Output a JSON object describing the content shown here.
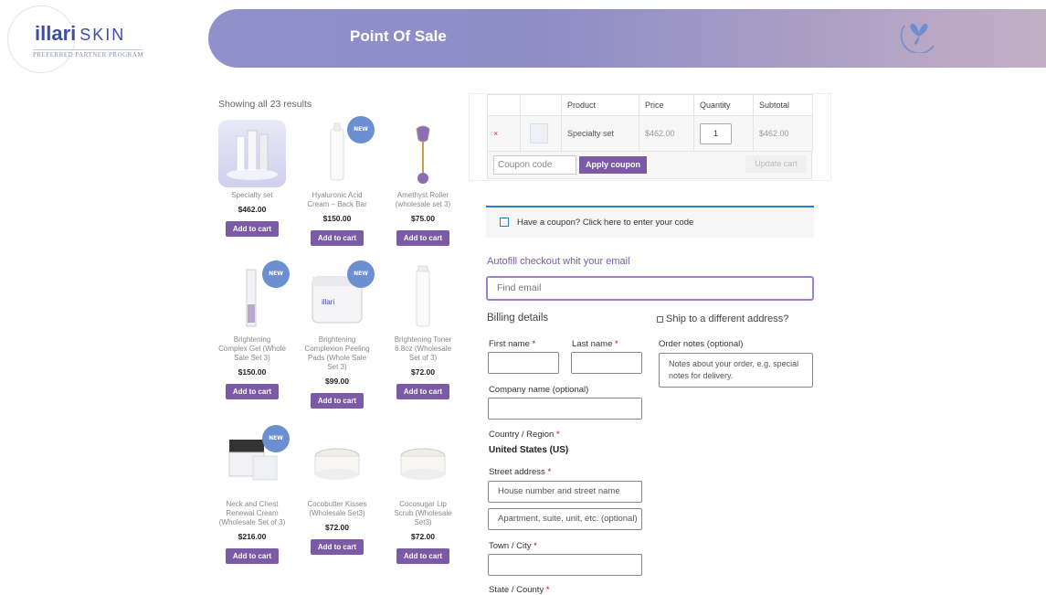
{
  "brand": {
    "name": "illari",
    "suffix": "SKIN",
    "tagline": "PREFERRED PARTNER PROGRAM"
  },
  "header": {
    "title": "Point Of Sale",
    "icon": "butterfly-icon"
  },
  "products": {
    "showing": "Showing all 23 results",
    "items": [
      {
        "name": "Specialty set",
        "price": "$462.00",
        "button": "Add to cart",
        "new": false
      },
      {
        "name": "Hyaluronic Acid Cream – Back Bar",
        "price": "$150.00",
        "button": "Add to cart",
        "new": true
      },
      {
        "name": "Amethyst Roller (wholesale set 3)",
        "price": "$75.00",
        "button": "Add to cart",
        "new": false
      },
      {
        "name": "Brightening Complex Gel (Whole Sale Set 3)",
        "price": "$150.00",
        "button": "Add to cart",
        "new": true
      },
      {
        "name": "Brightening Complexion Peeling Pads (Whole Sale Set 3)",
        "price": "$99.00",
        "button": "Add to cart",
        "new": true
      },
      {
        "name": "Brightening Toner 6.8oz (Wholesale Set of 3)",
        "price": "$72.00",
        "button": "Add to cart",
        "new": false
      },
      {
        "name": "Neck and Chest Renewal Cream (Wholesale Set of 3)",
        "price": "$216.00",
        "button": "Add to cart",
        "new": true
      },
      {
        "name": "Cocobutter Kisses (Wholesale Set3)",
        "price": "$72.00",
        "button": "Add to cart",
        "new": false
      },
      {
        "name": "Cocosugar Lip Scrub (Wholesale Set3)",
        "price": "$72.00",
        "button": "Add to cart",
        "new": false
      }
    ],
    "new_badge": "NEW"
  },
  "cart": {
    "headers": [
      "",
      "",
      "Product",
      "Price",
      "Quantity",
      "Subtotal"
    ],
    "rows": [
      {
        "remove": "×",
        "product": "Specialty set",
        "price": "$462.00",
        "quantity": "1",
        "subtotal": "$462.00"
      }
    ],
    "coupon_placeholder": "Coupon code",
    "apply_label": "Apply coupon",
    "update_label": "Update cart"
  },
  "checkout": {
    "coupon_notice": "Have a coupon? Click here to enter your code",
    "autofill_label": "Autofill checkout whit your email",
    "find_email_placeholder": "Find email",
    "billing_title": "Billing details",
    "ship_label": "Ship to a different address?",
    "first_name": "First name",
    "last_name": "Last name",
    "company": "Company name (optional)",
    "country_label": "Country / Region",
    "country_value": "United States (US)",
    "street_label": "Street address",
    "street_placeholder": "House number and street name",
    "apartment_placeholder": "Apartment, suite, unit, etc. (optional)",
    "city_label": "Town / City",
    "state_label": "State / County",
    "notes_label": "Order notes (optional)",
    "notes_placeholder": "Notes about your order, e.g. special notes for delivery.",
    "required_mark": "*"
  },
  "colors": {
    "accent": "#7b5ba6",
    "badge": "#6b8fd1",
    "banner_start": "#8f91cc",
    "banner_end": "#c2b0c4",
    "notice_border": "#1e85be"
  }
}
